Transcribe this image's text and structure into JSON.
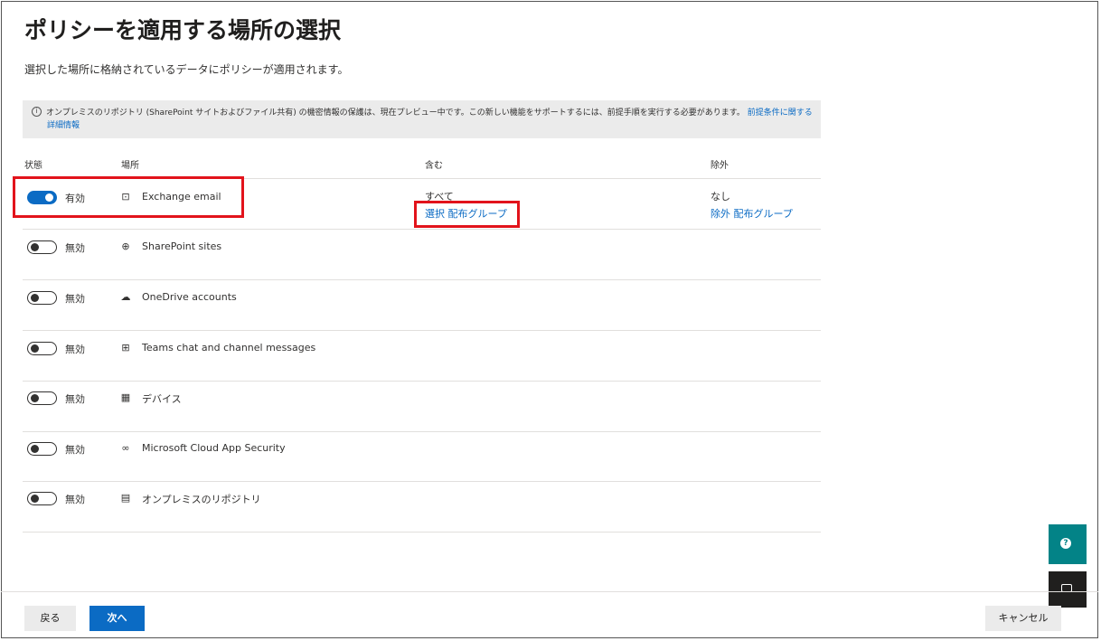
{
  "page": {
    "title": "ポリシーを適用する場所の選択",
    "subtitle": "選択した場所に格納されているデータにポリシーが適用されます。"
  },
  "info": {
    "icon": "info-icon",
    "text": "オンプレミスのリポジトリ (SharePoint サイトおよびファイル共有) の機密情報の保護は、現在プレビュー中です。この新しい機能をサポートするには、前提手順を実行する必要があります。",
    "link_part1": "前提条件に関する",
    "link_part2": "詳細情報"
  },
  "columns": {
    "status": "状態",
    "location": "場所",
    "include": "含む",
    "exclude": "除外"
  },
  "rows": [
    {
      "on": true,
      "status": "有効",
      "icon": "exchange-icon",
      "name": "Exchange email",
      "include_text": "すべて",
      "include_link": "選択 配布グループ",
      "exclude_text": "なし",
      "exclude_link": "除外 配布グループ"
    },
    {
      "on": false,
      "status": "無効",
      "icon": "sharepoint-icon",
      "name": "SharePoint sites"
    },
    {
      "on": false,
      "status": "無効",
      "icon": "onedrive-icon",
      "name": "OneDrive accounts"
    },
    {
      "on": false,
      "status": "無効",
      "icon": "teams-icon",
      "name": "Teams chat and channel messages"
    },
    {
      "on": false,
      "status": "無効",
      "icon": "windows-icon",
      "name": "デバイス"
    },
    {
      "on": false,
      "status": "無効",
      "icon": "mcas-icon",
      "name": "Microsoft Cloud App Security"
    },
    {
      "on": false,
      "status": "無効",
      "icon": "repository-icon",
      "name": "オンプレミスのリポジトリ"
    }
  ],
  "footer": {
    "back": "戻る",
    "next": "次へ",
    "cancel": "キャンセル"
  },
  "colors": {
    "accent": "#0b6bc4",
    "highlight": "#e2131b",
    "help": "#038387"
  }
}
